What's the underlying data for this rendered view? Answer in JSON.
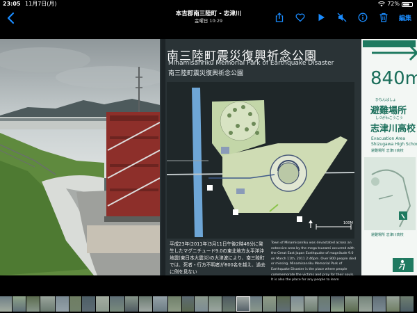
{
  "status_bar": {
    "time": "23:05",
    "date": "11月7日(月)",
    "battery_text": "72%",
    "battery_level": 0.72
  },
  "nav": {
    "title": "本吉郡南三陸町 - 志津川",
    "subtitle": "金曜日 10:29",
    "edit_label": "編集",
    "icons": [
      "back-chevron-icon",
      "share-icon",
      "heart-icon",
      "play-icon",
      "mute-icon",
      "info-icon",
      "trash-icon"
    ],
    "accent_color": "#1a8cff"
  },
  "photo": {
    "sign": {
      "title_jp": "南三陸町震災復興祈念公園",
      "title_en": "Minamisanriku Memorial Park of Earthquake Disaster",
      "title_jp_small": "南三陸町震災復興祈念公園",
      "body_jp": "平成23年(2011年)3月11日午後2時46分に発生したマグニチュード9.0の東北地方太平洋沖地震(東日本大震災)の大津波により、南三陸町では、死者・行方不明者が800名を越え、過去に例を見ない",
      "body_en": "Town of Minamisanriku was devastated across an extensive area by the mega tsunami occurred with the Great East Japan Earthquake of magnitude 9.0 on March 11th, 2011 2:46pm. Over 800 people died or missing. Minamisanriku Memorial Park of Earthquake Disaster is the place where people commemorate the victims and pray for their souls. It is also the place for any people to learn",
      "scale_label": "100M"
    },
    "green_sign": {
      "distance": "840m",
      "ruby_evac": "ひなんばしょ",
      "evac_jp": "避難場所",
      "ruby_school": "しづがわこうこう",
      "school_jp": "志津川高校",
      "evac_en_1": "Evacuation Area",
      "evac_en_2": "Shizugawa High School",
      "small_label": "避難場所 志津川高校",
      "small_label_2": "避難場所 志津川高校",
      "sign_color": "#1a6e5a"
    }
  }
}
